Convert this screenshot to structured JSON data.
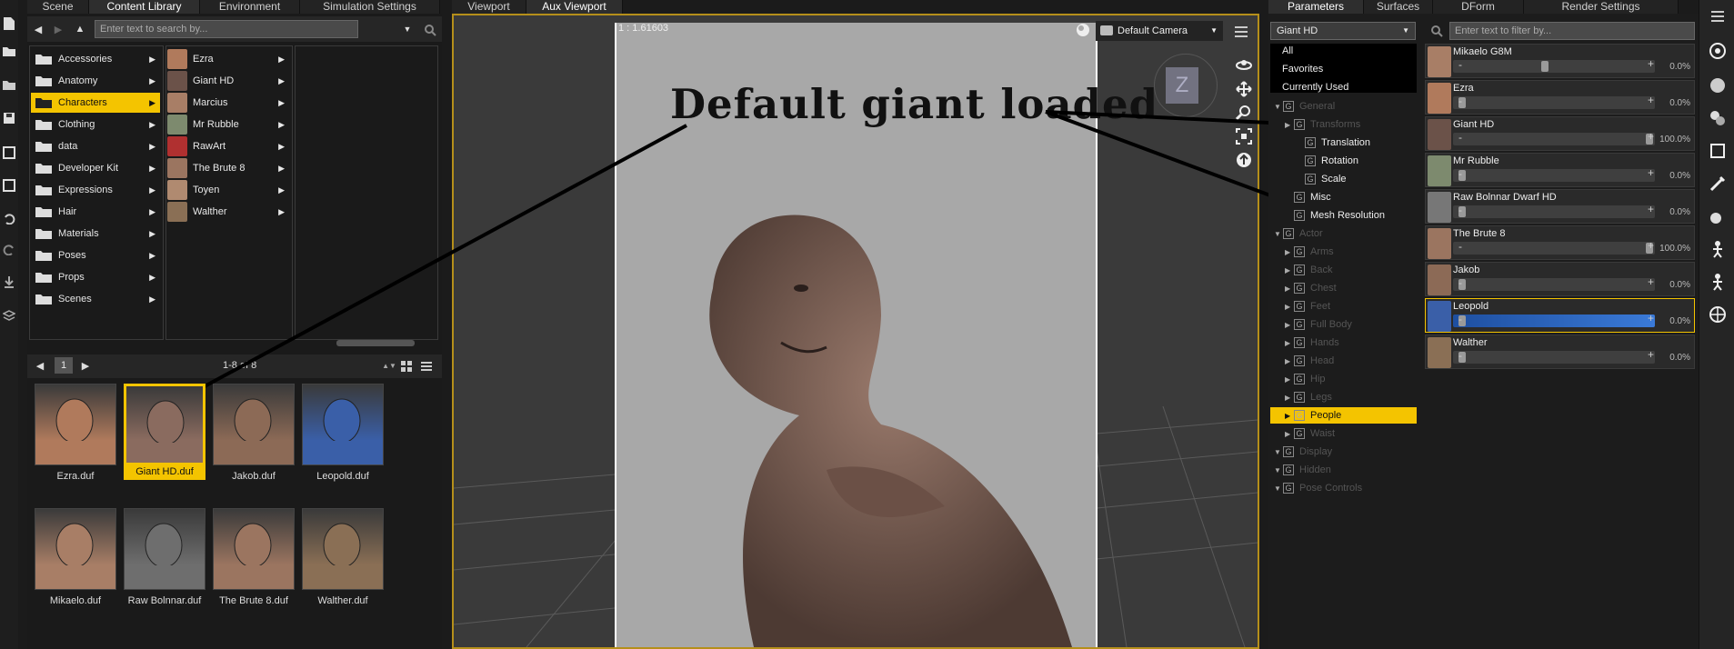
{
  "left_tabs": [
    "Scene",
    "Content Library",
    "Environment",
    "Simulation Settings"
  ],
  "center_tabs": [
    "Viewport",
    "Aux Viewport"
  ],
  "right_tabs": [
    "Parameters",
    "Surfaces",
    "DForm",
    "Render Settings"
  ],
  "library": {
    "search_placeholder": "Enter text to search by...",
    "categories": [
      "Accessories",
      "Anatomy",
      "Characters",
      "Clothing",
      "data",
      "Developer Kit",
      "Expressions",
      "Hair",
      "Materials",
      "Poses",
      "Props",
      "Scenes"
    ],
    "selected_category": "Characters",
    "characters": [
      "Ezra",
      "Giant HD",
      "Marcius",
      "Mr Rubble",
      "RawArt",
      "The Brute 8",
      "Toyen",
      "Walther"
    ],
    "page": "1",
    "count_text": "1-8 of 8",
    "thumbs": [
      {
        "label": "Ezra.duf",
        "color": "#b07a5c"
      },
      {
        "label": "Giant HD.duf",
        "color": "#8a6b5f"
      },
      {
        "label": "Jakob.duf",
        "color": "#8c6a56"
      },
      {
        "label": "Leopold.duf",
        "color": "#3a5fa8"
      },
      {
        "label": "Mikaelo.duf",
        "color": "#a87e66"
      },
      {
        "label": "Raw Bolnnar.duf",
        "color": "#6e6e6e"
      },
      {
        "label": "The Brute 8.duf",
        "color": "#9b7560"
      },
      {
        "label": "Walther.duf",
        "color": "#8a6f55"
      }
    ]
  },
  "viewport": {
    "ratio": "1 : 1.61603",
    "camera": "Default Camera",
    "annotation": "Default giant loaded",
    "cube_label": "Z"
  },
  "params": {
    "node": "Giant HD",
    "filter_placeholder": "Enter text to filter by...",
    "quick": [
      "All",
      "Favorites",
      "Currently Used"
    ],
    "tree": [
      {
        "label": "General",
        "lvl": 0,
        "bright": false,
        "tri": true
      },
      {
        "label": "Transforms",
        "lvl": 1,
        "bright": false,
        "tri": true
      },
      {
        "label": "Translation",
        "lvl": 2,
        "bright": true,
        "tri": false
      },
      {
        "label": "Rotation",
        "lvl": 2,
        "bright": true,
        "tri": false
      },
      {
        "label": "Scale",
        "lvl": 2,
        "bright": true,
        "tri": false
      },
      {
        "label": "Misc",
        "lvl": 1,
        "bright": true,
        "tri": false
      },
      {
        "label": "Mesh Resolution",
        "lvl": 1,
        "bright": true,
        "tri": false
      },
      {
        "label": "Actor",
        "lvl": 0,
        "bright": false,
        "tri": true
      },
      {
        "label": "Arms",
        "lvl": 1,
        "bright": false,
        "tri": true
      },
      {
        "label": "Back",
        "lvl": 1,
        "bright": false,
        "tri": true
      },
      {
        "label": "Chest",
        "lvl": 1,
        "bright": false,
        "tri": true
      },
      {
        "label": "Feet",
        "lvl": 1,
        "bright": false,
        "tri": true
      },
      {
        "label": "Full Body",
        "lvl": 1,
        "bright": false,
        "tri": true
      },
      {
        "label": "Hands",
        "lvl": 1,
        "bright": false,
        "tri": true
      },
      {
        "label": "Head",
        "lvl": 1,
        "bright": false,
        "tri": true
      },
      {
        "label": "Hip",
        "lvl": 1,
        "bright": false,
        "tri": true
      },
      {
        "label": "Legs",
        "lvl": 1,
        "bright": false,
        "tri": true
      },
      {
        "label": "People",
        "lvl": 1,
        "bright": true,
        "tri": true,
        "sel": true
      },
      {
        "label": "Waist",
        "lvl": 1,
        "bright": false,
        "tri": true
      },
      {
        "label": "Display",
        "lvl": 0,
        "bright": false,
        "tri": true
      },
      {
        "label": "Hidden",
        "lvl": 0,
        "bright": false,
        "tri": true
      },
      {
        "label": "Pose Controls",
        "lvl": 0,
        "bright": false,
        "tri": true
      }
    ],
    "sliders": [
      {
        "name": "Mikaelo G8M",
        "value": "0.0%",
        "pos": 0.44,
        "color": "#a87e66"
      },
      {
        "name": "Ezra",
        "value": "0.0%",
        "pos": 0.0,
        "color": "#b07a5c"
      },
      {
        "name": "Giant HD",
        "value": "100.0%",
        "pos": 1.0,
        "color": "#6b5249"
      },
      {
        "name": "Mr Rubble",
        "value": "0.0%",
        "pos": 0.0,
        "color": "#7d8a6e"
      },
      {
        "name": "Raw Bolnnar Dwarf HD",
        "value": "0.0%",
        "pos": 0.0,
        "color": "#777777"
      },
      {
        "name": "The Brute 8",
        "value": "100.0%",
        "pos": 1.0,
        "color": "#9b7560"
      },
      {
        "name": "Jakob",
        "value": "0.0%",
        "pos": 0.0,
        "color": "#8c6a56"
      },
      {
        "name": "Leopold",
        "value": "0.0%",
        "pos": 0.0,
        "color": "#3a5fa8"
      },
      {
        "name": "Walther",
        "value": "0.0%",
        "pos": 0.0,
        "color": "#8a6f55"
      }
    ]
  }
}
